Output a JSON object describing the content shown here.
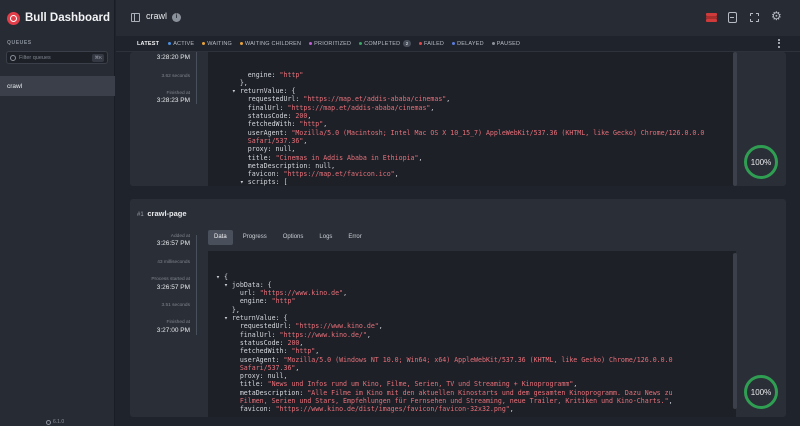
{
  "app": {
    "title": "Bull Dashboard",
    "version": "6.1.0"
  },
  "sidebar": {
    "section_label": "QUEUES",
    "filter_placeholder": "Filter queues",
    "filter_shortcut": "⌘K",
    "queues": [
      {
        "label": "crawl",
        "active": true
      }
    ]
  },
  "header": {
    "queue_name": "crawl",
    "icons": [
      "redis-icon",
      "docs-icon",
      "fullscreen-icon",
      "settings-gear-icon"
    ]
  },
  "status_tabs": [
    {
      "label": "LATEST",
      "active": true
    },
    {
      "label": "ACTIVE",
      "color": "#4a90e2"
    },
    {
      "label": "WAITING",
      "color": "#e8a33a"
    },
    {
      "label": "WAITING CHILDREN",
      "color": "#e8a33a"
    },
    {
      "label": "PRIORITIZED",
      "color": "#c05fd6"
    },
    {
      "label": "COMPLETED",
      "color": "#3aa664",
      "count": "2"
    },
    {
      "label": "FAILED",
      "color": "#e0474c"
    },
    {
      "label": "DELAYED",
      "color": "#5b7de0"
    },
    {
      "label": "PAUSED",
      "color": "#8b919b"
    }
  ],
  "jobs": [
    {
      "timeline": {
        "time_top": "3:28:20 PM",
        "duration": "3.62 seconds",
        "finished_label": "Finished at",
        "finished_at": "3:28:23 PM"
      },
      "progress": "100%",
      "code_lines": [
        {
          "indent": 4,
          "segs": [
            [
              "k",
              "engine: "
            ],
            [
              "s",
              "\"http\""
            ]
          ]
        },
        {
          "indent": 3,
          "segs": [
            [
              "p",
              "},"
            ]
          ]
        },
        {
          "indent": 2,
          "segs": [
            [
              "tri",
              "▾ "
            ],
            [
              "k",
              "returnValue: {"
            ]
          ]
        },
        {
          "indent": 4,
          "segs": [
            [
              "k",
              "requestedUrl: "
            ],
            [
              "s",
              "\"https://map.et/addis-ababa/cinemas\""
            ],
            [
              "p",
              ","
            ]
          ]
        },
        {
          "indent": 4,
          "segs": [
            [
              "k",
              "finalUrl: "
            ],
            [
              "s",
              "\"https://map.et/addis-ababa/cinemas\""
            ],
            [
              "p",
              ","
            ]
          ]
        },
        {
          "indent": 4,
          "segs": [
            [
              "k",
              "statusCode: "
            ],
            [
              "n",
              "200"
            ],
            [
              "p",
              ","
            ]
          ]
        },
        {
          "indent": 4,
          "segs": [
            [
              "k",
              "fetchedWith: "
            ],
            [
              "s",
              "\"http\""
            ],
            [
              "p",
              ","
            ]
          ]
        },
        {
          "indent": 4,
          "segs": [
            [
              "k",
              "userAgent: "
            ],
            [
              "s",
              "\"Mozilla/5.0 (Macintosh; Intel Mac OS X 10_15_7) AppleWebKit/537.36 (KHTML, like Gecko) Chrome/126.0.0.0"
            ]
          ]
        },
        {
          "indent": 4,
          "segs": [
            [
              "s",
              "Safari/537.36\""
            ],
            [
              "p",
              ","
            ]
          ]
        },
        {
          "indent": 4,
          "segs": [
            [
              "k",
              "proxy: null,"
            ]
          ]
        },
        {
          "indent": 4,
          "segs": [
            [
              "k",
              "title: "
            ],
            [
              "s",
              "\"Cinemas in Addis Ababa in Ethiopia\""
            ],
            [
              "p",
              ","
            ]
          ]
        },
        {
          "indent": 4,
          "segs": [
            [
              "k",
              "metaDescription: null,"
            ]
          ]
        },
        {
          "indent": 4,
          "segs": [
            [
              "k",
              "favicon: "
            ],
            [
              "s",
              "\"https://map.et/favicon.ico\""
            ],
            [
              "p",
              ","
            ]
          ]
        },
        {
          "indent": 3,
          "segs": [
            [
              "tri",
              "▾ "
            ],
            [
              "k",
              "scripts: ["
            ]
          ]
        }
      ]
    },
    {
      "number": "#1",
      "name": "crawl-page",
      "timeline": {
        "added_label": "Added at",
        "added_at": "3:26:57 PM",
        "wait": "43 milliseconds",
        "started_label": "Process started at",
        "started_at": "3:26:57 PM",
        "duration": "3.51 seconds",
        "finished_label": "Finished at",
        "finished_at": "3:27:00 PM"
      },
      "detail_tabs": [
        "Data",
        "Progress",
        "Options",
        "Logs",
        "Error"
      ],
      "progress": "100%",
      "code_lines": [
        {
          "indent": 0,
          "segs": [
            [
              "tri",
              "▾ "
            ],
            [
              "p",
              "{"
            ]
          ]
        },
        {
          "indent": 1,
          "segs": [
            [
              "tri",
              "▾ "
            ],
            [
              "k",
              "jobData: {"
            ]
          ]
        },
        {
          "indent": 3,
          "segs": [
            [
              "k",
              "url: "
            ],
            [
              "s",
              "\"https://www.kino.de\""
            ],
            [
              "p",
              ","
            ]
          ]
        },
        {
          "indent": 3,
          "segs": [
            [
              "k",
              "engine: "
            ],
            [
              "s",
              "\"http\""
            ]
          ]
        },
        {
          "indent": 2,
          "segs": [
            [
              "p",
              "},"
            ]
          ]
        },
        {
          "indent": 1,
          "segs": [
            [
              "tri",
              "▾ "
            ],
            [
              "k",
              "returnValue: {"
            ]
          ]
        },
        {
          "indent": 3,
          "segs": [
            [
              "k",
              "requestedUrl: "
            ],
            [
              "s",
              "\"https://www.kino.de\""
            ],
            [
              "p",
              ","
            ]
          ]
        },
        {
          "indent": 3,
          "segs": [
            [
              "k",
              "finalUrl: "
            ],
            [
              "s",
              "\"https://www.kino.de/\""
            ],
            [
              "p",
              ","
            ]
          ]
        },
        {
          "indent": 3,
          "segs": [
            [
              "k",
              "statusCode: "
            ],
            [
              "n",
              "200"
            ],
            [
              "p",
              ","
            ]
          ]
        },
        {
          "indent": 3,
          "segs": [
            [
              "k",
              "fetchedWith: "
            ],
            [
              "s",
              "\"http\""
            ],
            [
              "p",
              ","
            ]
          ]
        },
        {
          "indent": 3,
          "segs": [
            [
              "k",
              "userAgent: "
            ],
            [
              "s",
              "\"Mozilla/5.0 (Windows NT 10.0; Win64; x64) AppleWebKit/537.36 (KHTML, like Gecko) Chrome/126.0.0.0"
            ]
          ]
        },
        {
          "indent": 3,
          "segs": [
            [
              "s",
              "Safari/537.36\""
            ],
            [
              "p",
              ","
            ]
          ]
        },
        {
          "indent": 3,
          "segs": [
            [
              "k",
              "proxy: null,"
            ]
          ]
        },
        {
          "indent": 3,
          "segs": [
            [
              "k",
              "title: "
            ],
            [
              "s",
              "\"News und Infos rund um Kino, Filme, Serien, TV und Streaming + Kinoprogramm\""
            ],
            [
              "p",
              ","
            ]
          ]
        },
        {
          "indent": 3,
          "segs": [
            [
              "k",
              "metaDescription: "
            ],
            [
              "s",
              "\"Alle Filme im Kino mit den aktuellen Kinostarts und dem gesamten Kinoprogramm. Dazu News zu"
            ]
          ]
        },
        {
          "indent": 3,
          "segs": [
            [
              "s",
              "Filmen, Serien und Stars, Empfehlungen für Fernsehen und Streaming, neue Trailer, Kritiken und Kino-Charts.\""
            ],
            [
              "p",
              ","
            ]
          ]
        },
        {
          "indent": 3,
          "segs": [
            [
              "k",
              "favicon: "
            ],
            [
              "s",
              "\"https://www.kino.de/dist/images/favicon/favicon-32x32.png\""
            ],
            [
              "p",
              ","
            ]
          ]
        }
      ]
    }
  ]
}
